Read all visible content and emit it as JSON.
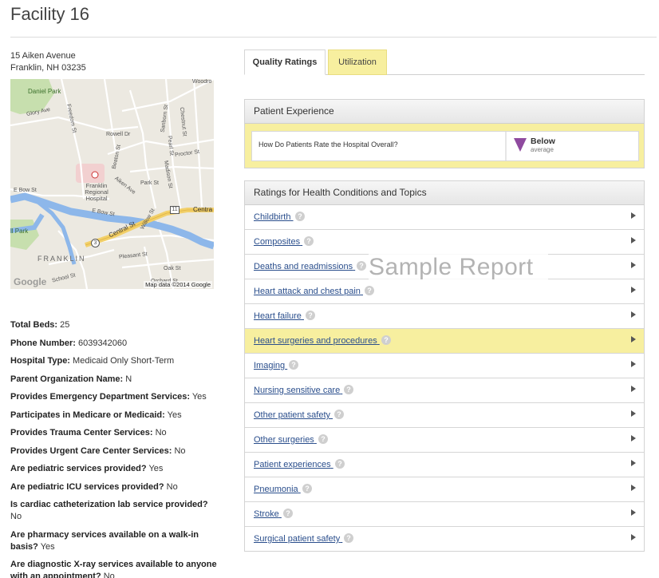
{
  "facility": {
    "title": "Facility 16",
    "address_line1": "15 Aiken Avenue",
    "address_line2": "Franklin, NH 03235"
  },
  "map": {
    "labels": {
      "daniel_park": "Daniel Park",
      "glory_ave": "Glory Ave",
      "freedom_st": "Freedom St",
      "rowell_dr": "Rowell Dr",
      "beaton_st": "Beaton St",
      "hospital": "Franklin Regional Hospital",
      "aiken_ave": "Aiken Ave",
      "e_bow_st_1": "E Bow St",
      "e_bow_st_2": "E Bow St",
      "central_st_1": "Central St",
      "central_st_2": "Centra",
      "route_11": "11",
      "route_3": "3",
      "willow_st": "Willow St",
      "park_st": "Park St",
      "pleasant_st": "Pleasant St",
      "school_st": "School St",
      "oak_st": "Oak St",
      "orchard_st": "Orchard St",
      "proctor_st": "Proctor St",
      "sanborn_st": "Sanborn St",
      "chestnut_st": "Chestnut St",
      "pearl_st": "Pearl St",
      "madison_st": "Madison St",
      "woodrow": "Woodro",
      "park_left": "ll Park",
      "town": "FRANKLIN",
      "logo": "Google",
      "credit": "Map data ©2014 Google"
    }
  },
  "facts": [
    {
      "label": "Total Beds:",
      "value": "25"
    },
    {
      "label": "Phone Number:",
      "value": "6039342060"
    },
    {
      "label": "Hospital Type:",
      "value": "Medicaid Only Short-Term"
    },
    {
      "label": "Parent Organization Name:",
      "value": "N"
    },
    {
      "label": "Provides Emergency Department Services:",
      "value": "Yes"
    },
    {
      "label": "Participates in Medicare or Medicaid:",
      "value": "Yes"
    },
    {
      "label": "Provides Trauma Center Services:",
      "value": "No"
    },
    {
      "label": "Provides Urgent Care Center Services:",
      "value": "No"
    },
    {
      "label": "Are pediatric services provided?",
      "value": "Yes"
    },
    {
      "label": "Are pediatric ICU services provided?",
      "value": "No"
    },
    {
      "label": "Is cardiac catheterization lab service provided?",
      "value": "No"
    },
    {
      "label": "Are pharmacy services available on a walk-in basis?",
      "value": "Yes"
    },
    {
      "label": "Are diagnostic X-ray services available to anyone with an appointment?",
      "value": "No"
    }
  ],
  "tabs": [
    {
      "label": "Quality Ratings",
      "active": true
    },
    {
      "label": "Utilization",
      "active": false
    }
  ],
  "patient_experience": {
    "heading": "Patient Experience",
    "question": "How Do Patients Rate the Hospital Overall?",
    "rating": "Below",
    "rating_sub": "average",
    "rating_color": "#8f4a9f"
  },
  "topics": {
    "heading": "Ratings for Health Conditions and Topics",
    "help_glyph": "?",
    "highlight_color": "#f7ef9f",
    "items": [
      {
        "label": "Childbirth"
      },
      {
        "label": "Composites"
      },
      {
        "label": "Deaths and readmissions"
      },
      {
        "label": "Heart attack and chest pain"
      },
      {
        "label": "Heart failure"
      },
      {
        "label": "Heart surgeries and procedures"
      },
      {
        "label": "Imaging"
      },
      {
        "label": "Nursing sensitive care"
      },
      {
        "label": "Other patient safety"
      },
      {
        "label": "Other surgeries"
      },
      {
        "label": "Patient experiences"
      },
      {
        "label": "Pneumonia"
      },
      {
        "label": "Stroke"
      },
      {
        "label": "Surgical patient safety"
      }
    ]
  },
  "watermark": "Sample Report"
}
